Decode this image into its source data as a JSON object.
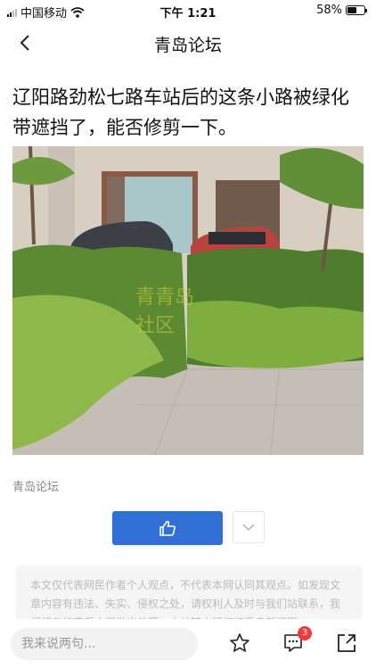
{
  "status_bar": {
    "carrier": "中国移动",
    "time": "下午 1:21",
    "battery_text": "58%",
    "battery_level": 0.58
  },
  "nav": {
    "title": "青岛论坛",
    "back_icon": "chevron-left-icon"
  },
  "article": {
    "title": "辽阳路劲松七路车站后的这条小路被绿化带遮挡了，能否修剪一下。",
    "source": "青岛论坛",
    "like_icon": "thumbs-up-icon",
    "dislike_icon": "chevron-down-icon",
    "disclaimer": "本文仅代表网民作者个人观点，不代表本网认同其观点。如发现文章内容有违法、失实、侵权之处，请权利人及时与我们站联系，我们将在核实后立即做出处理，本站转文版权归青岛新闻网"
  },
  "bottom_bar": {
    "comment_placeholder": "我来说两句...",
    "comment_count": "3",
    "icons": [
      "star-icon",
      "comment-icon",
      "share-icon"
    ]
  },
  "colors": {
    "accent": "#2f6fd6",
    "badge": "#ee3b3b"
  }
}
